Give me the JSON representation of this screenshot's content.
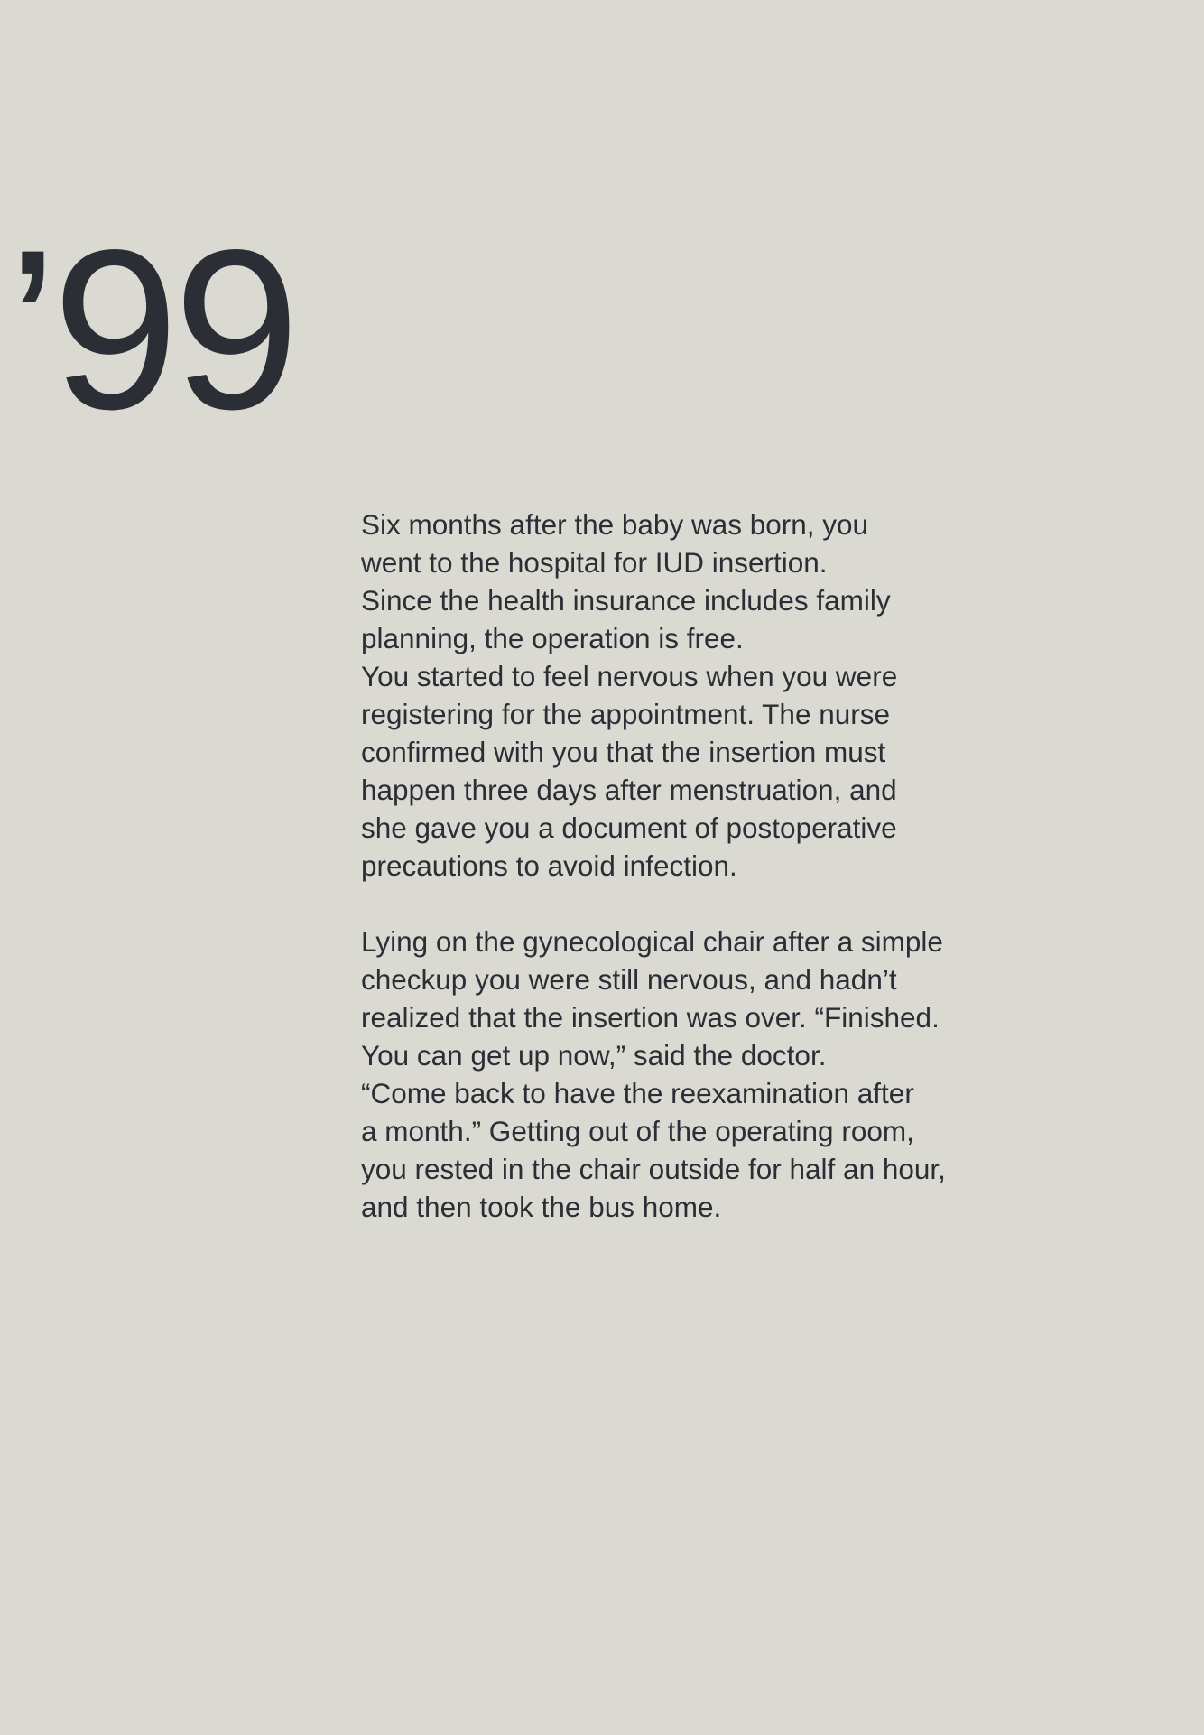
{
  "year_label": "’99",
  "paragraphs": [
    {
      "lines": [
        "Six months after the baby was born, you",
        "went to the hospital for IUD insertion.",
        "Since the health insurance includes family",
        "planning, the operation is free.",
        "You started to feel nervous when you were",
        "registering for the appointment. The nurse",
        "confirmed with you that the insertion must",
        "happen three days after menstruation, and",
        "she gave you a document of postoperative",
        "precautions to avoid infection."
      ]
    },
    {
      "lines": [
        "Lying on the gynecological chair after a simple",
        "checkup you were still nervous, and hadn’t",
        "realized that the insertion was over. “Finished.",
        "You can get up now,” said the doctor.",
        "“Come back to have the reexamination after",
        "a month.” Getting out of the operating room,",
        "you rested in the chair outside for half an hour,",
        "and then took the bus home."
      ]
    }
  ]
}
